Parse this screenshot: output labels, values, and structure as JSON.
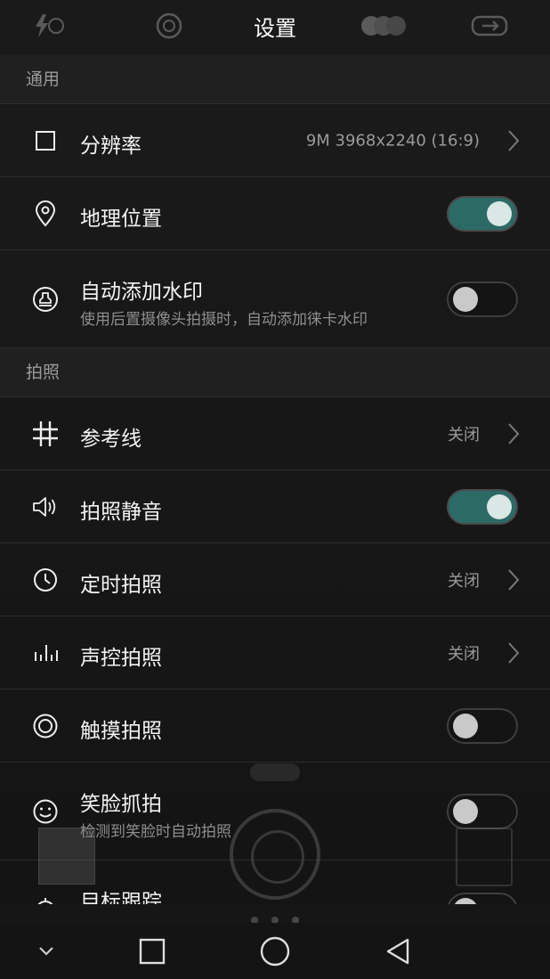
{
  "header": {
    "title": "设置",
    "ghost_icons": [
      "flash-auto-icon",
      "filter-icon",
      "color-mode-icon",
      "switch-camera-icon"
    ]
  },
  "sections": {
    "general": {
      "title": "通用",
      "resolution": {
        "label": "分辨率",
        "value": "9M 3968x2240 (16:9)",
        "icon": "square-icon"
      },
      "location": {
        "label": "地理位置",
        "toggle": true,
        "icon": "location-pin-icon"
      },
      "watermark": {
        "label": "自动添加水印",
        "sub": "使用后置摄像头拍摄时，自动添加徕卡水印",
        "toggle": false,
        "icon": "stamp-icon"
      }
    },
    "photo": {
      "title": "拍照",
      "grid": {
        "label": "参考线",
        "value": "关闭",
        "icon": "grid-icon"
      },
      "mute": {
        "label": "拍照静音",
        "toggle": true,
        "icon": "speaker-icon"
      },
      "timer": {
        "label": "定时拍照",
        "value": "关闭",
        "icon": "clock-icon"
      },
      "voice": {
        "label": "声控拍照",
        "value": "关闭",
        "icon": "audio-bars-icon"
      },
      "touch": {
        "label": "触摸拍照",
        "toggle": false,
        "icon": "target-icon"
      },
      "smile": {
        "label": "笑脸抓拍",
        "sub": "检测到笑脸时自动拍照",
        "toggle": false,
        "icon": "smile-icon"
      },
      "tracking": {
        "label": "目标跟踪",
        "toggle": false,
        "icon": "tracking-icon"
      }
    }
  },
  "navbar": {
    "items": [
      "chevron-down-icon",
      "recents-square-icon",
      "home-circle-icon",
      "back-triangle-icon"
    ]
  },
  "colors": {
    "toggle_on": "#2c6a66",
    "background": "#1b1b1b"
  }
}
